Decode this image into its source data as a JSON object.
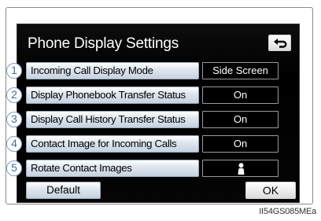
{
  "title": "Phone Display Settings",
  "back_icon": "back-arrow-icon",
  "rows": [
    {
      "number": "1",
      "label": "Incoming Call Display Mode",
      "value": "Side Screen"
    },
    {
      "number": "2",
      "label": "Display Phonebook Transfer Status",
      "value": "On"
    },
    {
      "number": "3",
      "label": "Display Call History Transfer Status",
      "value": "On"
    },
    {
      "number": "4",
      "label": "Contact Image for Incoming Calls",
      "value": "On"
    },
    {
      "number": "5",
      "label": "Rotate Contact Images",
      "value": "",
      "value_icon": "person-icon"
    }
  ],
  "buttons": {
    "default": "Default",
    "ok": "OK"
  },
  "image_code": "II54GS085MEa",
  "colors": {
    "screen_bg": "#000000",
    "button_gradient_top": "#ffffff",
    "button_gradient_bottom": "#c6d2e0",
    "callout_blue": "#3f6fa6"
  }
}
